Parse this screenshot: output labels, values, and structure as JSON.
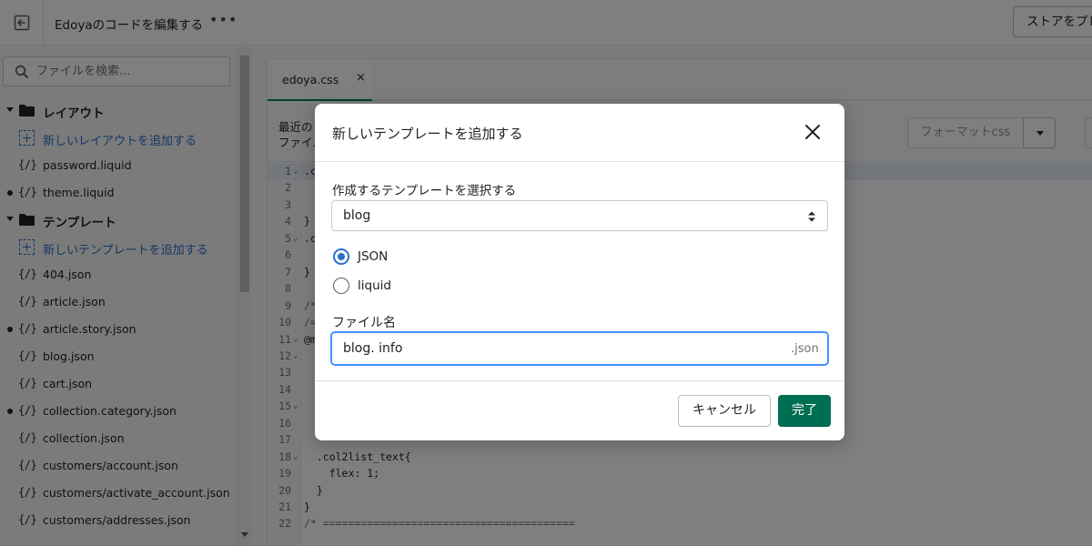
{
  "topbar": {
    "title": "Edoyaのコードを編集する",
    "more": "•••",
    "store_button": "ストアをプレビュー"
  },
  "sidebar": {
    "search_placeholder": "ファイルを検索...",
    "tree": [
      {
        "kind": "folder",
        "label": "レイアウト"
      },
      {
        "kind": "add",
        "label": "新しいレイアウトを追加する"
      },
      {
        "kind": "file",
        "label": "password.liquid",
        "modified": false
      },
      {
        "kind": "file",
        "label": "theme.liquid",
        "modified": true
      },
      {
        "kind": "folder",
        "label": "テンプレート"
      },
      {
        "kind": "add",
        "label": "新しいテンプレートを追加する"
      },
      {
        "kind": "file",
        "label": "404.json",
        "modified": false
      },
      {
        "kind": "file",
        "label": "article.json",
        "modified": false
      },
      {
        "kind": "file",
        "label": "article.story.json",
        "modified": true
      },
      {
        "kind": "file",
        "label": "blog.json",
        "modified": false
      },
      {
        "kind": "file",
        "label": "cart.json",
        "modified": false
      },
      {
        "kind": "file",
        "label": "collection.category.json",
        "modified": true
      },
      {
        "kind": "file",
        "label": "collection.json",
        "modified": false
      },
      {
        "kind": "file",
        "label": "customers/account.json",
        "modified": false
      },
      {
        "kind": "file",
        "label": "customers/activate_account.json",
        "modified": false
      },
      {
        "kind": "file",
        "label": "customers/addresses.json",
        "modified": false
      }
    ],
    "file_icon": "{/}"
  },
  "editor": {
    "tab_label": "edoya.css",
    "tab_close": "×",
    "info_line1": "最近の",
    "info_line2": "ファイル",
    "format_button": "フォーマットcss",
    "lines": [
      {
        "n": "1",
        "fold": true,
        "text": ".c",
        "comment": false
      },
      {
        "n": "2",
        "fold": false,
        "text": "",
        "comment": false
      },
      {
        "n": "3",
        "fold": false,
        "text": "",
        "comment": false
      },
      {
        "n": "4",
        "fold": false,
        "text": "}",
        "comment": false
      },
      {
        "n": "5",
        "fold": true,
        "text": ".c",
        "comment": false
      },
      {
        "n": "6",
        "fold": false,
        "text": "",
        "comment": false
      },
      {
        "n": "7",
        "fold": false,
        "text": "}",
        "comment": false
      },
      {
        "n": "8",
        "fold": false,
        "text": "",
        "comment": false
      },
      {
        "n": "9",
        "fold": false,
        "text": "/*",
        "comment": true
      },
      {
        "n": "10",
        "fold": false,
        "text": "/=",
        "comment": true
      },
      {
        "n": "11",
        "fold": true,
        "text": "@m",
        "comment": false
      },
      {
        "n": "12",
        "fold": true,
        "text": "",
        "comment": false
      },
      {
        "n": "13",
        "fold": false,
        "text": "",
        "comment": false
      },
      {
        "n": "14",
        "fold": false,
        "text": "",
        "comment": false
      },
      {
        "n": "15",
        "fold": true,
        "text": "",
        "comment": false
      },
      {
        "n": "16",
        "fold": false,
        "text": "",
        "comment": false
      },
      {
        "n": "17",
        "fold": false,
        "text": "",
        "comment": false
      },
      {
        "n": "18",
        "fold": true,
        "text": "  .col2list_text{",
        "comment": false
      },
      {
        "n": "19",
        "fold": false,
        "text": "    flex: 1;",
        "comment": false
      },
      {
        "n": "20",
        "fold": false,
        "text": "  }",
        "comment": false
      },
      {
        "n": "21",
        "fold": false,
        "text": "}",
        "comment": false
      },
      {
        "n": "22",
        "fold": false,
        "text": "/* ========================================",
        "comment": true
      }
    ]
  },
  "modal": {
    "title": "新しいテンプレートを追加する",
    "select_label": "作成するテンプレートを選択する",
    "select_value": "blog",
    "radios": [
      {
        "label": "JSON",
        "checked": true
      },
      {
        "label": "liquid",
        "checked": false
      }
    ],
    "filename_label": "ファイル名",
    "filename_value": "blog. info",
    "filename_suffix": ".json",
    "cancel_label": "キャンセル",
    "done_label": "完了"
  },
  "colors": {
    "accent_blue": "#2c6ecb",
    "primary_green": "#006e52",
    "focus_ring": "#458fff"
  }
}
